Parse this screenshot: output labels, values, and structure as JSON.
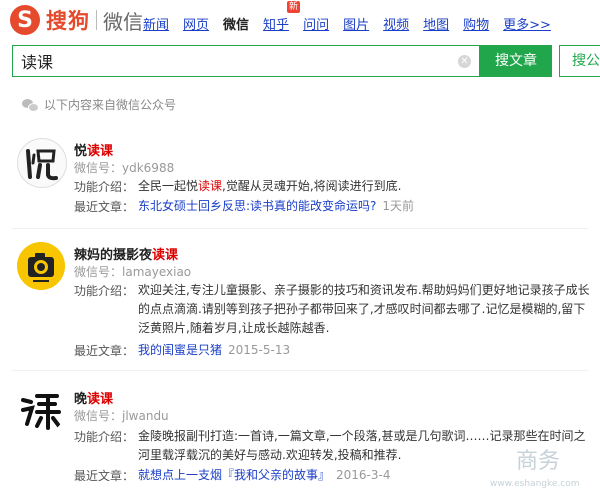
{
  "header": {
    "logo_text": "搜狗",
    "logo_sub": "微信",
    "nav": [
      {
        "label": "新闻"
      },
      {
        "label": "网页"
      },
      {
        "label": "微信"
      },
      {
        "label": "知乎"
      },
      {
        "label": "问问"
      },
      {
        "label": "图片"
      },
      {
        "label": "视频"
      },
      {
        "label": "地图"
      },
      {
        "label": "购物"
      },
      {
        "label": "更多>>"
      }
    ],
    "new_badge": "新"
  },
  "search": {
    "query": "读课",
    "clear_icon": "✕",
    "btn_article": "搜文章",
    "btn_account": "搜公"
  },
  "source_note": "以下内容来自微信公众号",
  "results": [
    {
      "title_prefix": "悦",
      "title_hl": "读课",
      "title_suffix": "",
      "id_label": "微信号：ydk6988",
      "intro_label": "功能介绍：",
      "intro_pre": "全民一起悦",
      "intro_hl": "读课",
      "intro_post": ",觉醒从灵魂开始,将阅读进行到底.",
      "recent_label": "最近文章：",
      "recent_link": "东北女硕士回乡反思:读书真的能改变命运吗?",
      "recent_date": "1天前"
    },
    {
      "title_prefix": "辣妈的摄影夜",
      "title_hl": "读课",
      "title_suffix": "",
      "id_label": "微信号：lamayexiao",
      "intro_label": "功能介绍：",
      "intro_pre": "欢迎关注,专注儿童摄影、亲子摄影的技巧和资讯发布.帮助妈妈们更好地记录孩子成长的点点滴滴.请别等到孩子把孙子都带回来了,才感叹时间都去哪了.记忆是模糊的,留下泛黄照片,随着岁月,让成长越陈越香.",
      "intro_hl": "",
      "intro_post": "",
      "recent_label": "最近文章：",
      "recent_link": "我的闺蜜是只猪",
      "recent_date": "2015-5-13"
    },
    {
      "title_prefix": "晚",
      "title_hl": "读课",
      "title_suffix": "",
      "id_label": "微信号：jlwandu",
      "intro_label": "功能介绍：",
      "intro_pre": "金陵晚报副刊打造:一首诗,一篇文章,一个段落,甚或是几句歌词……记录那些在时间之河里载浮载沉的美好与感动.欢迎转发,投稿和推荐.",
      "intro_hl": "",
      "intro_post": "",
      "recent_label": "最近文章：",
      "recent_link": "就想点上一支烟『我和父亲的故事』",
      "recent_date": "2016-3-4"
    }
  ],
  "watermark": {
    "text": "商务",
    "url": "www.eshangke.com"
  },
  "colors": {
    "accent": "#21a64b",
    "highlight": "#dd0000",
    "link": "#1a3ec7",
    "brand": "#e44a2b"
  }
}
